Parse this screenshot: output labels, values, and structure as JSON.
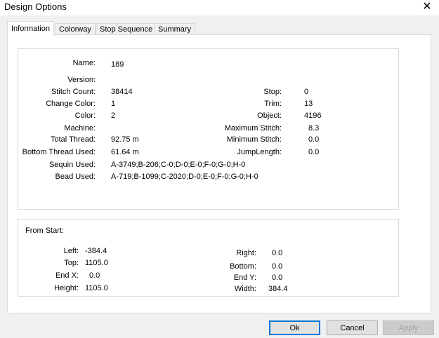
{
  "window": {
    "title": "Design Options",
    "close_glyph": "✕"
  },
  "tabs": [
    {
      "label": "Information",
      "active": true
    },
    {
      "label": "Colorway",
      "active": false
    },
    {
      "label": "Stop Sequence",
      "active": false
    },
    {
      "label": "Summary",
      "active": false
    }
  ],
  "info": {
    "name_label": "Name:",
    "name_value": "189",
    "version_label": "Version:",
    "version_value": "",
    "stitch_count_label": "Stitch Count:",
    "stitch_count_value": "38414",
    "change_color_label": "Change Color:",
    "change_color_value": "1",
    "color_label": "Color:",
    "color_value": "2",
    "machine_label": "Machine:",
    "machine_value": "",
    "total_thread_label": "Total Thread:",
    "total_thread_value": "92.75 m",
    "bottom_thread_label": "Bottom Thread Used:",
    "bottom_thread_value": "61.64 m",
    "sequin_label": "Sequin Used:",
    "sequin_value": "A-3749;B-206;C-0;D-0;E-0;F-0;G-0;H-0",
    "bead_label": "Bead Used:",
    "bead_value": "A-719;B-1099;C-2020;D-0;E-0;F-0;G-0;H-0",
    "stop_label": "Stop:",
    "stop_value": "0",
    "trim_label": "Trim:",
    "trim_value": "13",
    "object_label": "Object:",
    "object_value": "4196",
    "max_stitch_label": "Maximum Stitch:",
    "max_stitch_value": "8.3",
    "min_stitch_label": "Minimum Stitch:",
    "min_stitch_value": "0.0",
    "jump_length_label": "JumpLength:",
    "jump_length_value": "0.0"
  },
  "from_start": {
    "heading": "From Start:",
    "left_label": "Left:",
    "left_value": "-384.4",
    "top_label": "Top:",
    "top_value": "1105.0",
    "endx_label": "End X:",
    "endx_value": "0.0",
    "height_label": "Height:",
    "height_value": "1105.0",
    "right_label": "Right:",
    "right_value": "0.0",
    "bottom_label": "Bottom:",
    "bottom_value": "0.0",
    "endy_label": "End Y:",
    "endy_value": "0.0",
    "width_label": "Width:",
    "width_value": "384.4"
  },
  "buttons": {
    "ok": "Ok",
    "cancel": "Cancel",
    "apply": "Apply"
  }
}
